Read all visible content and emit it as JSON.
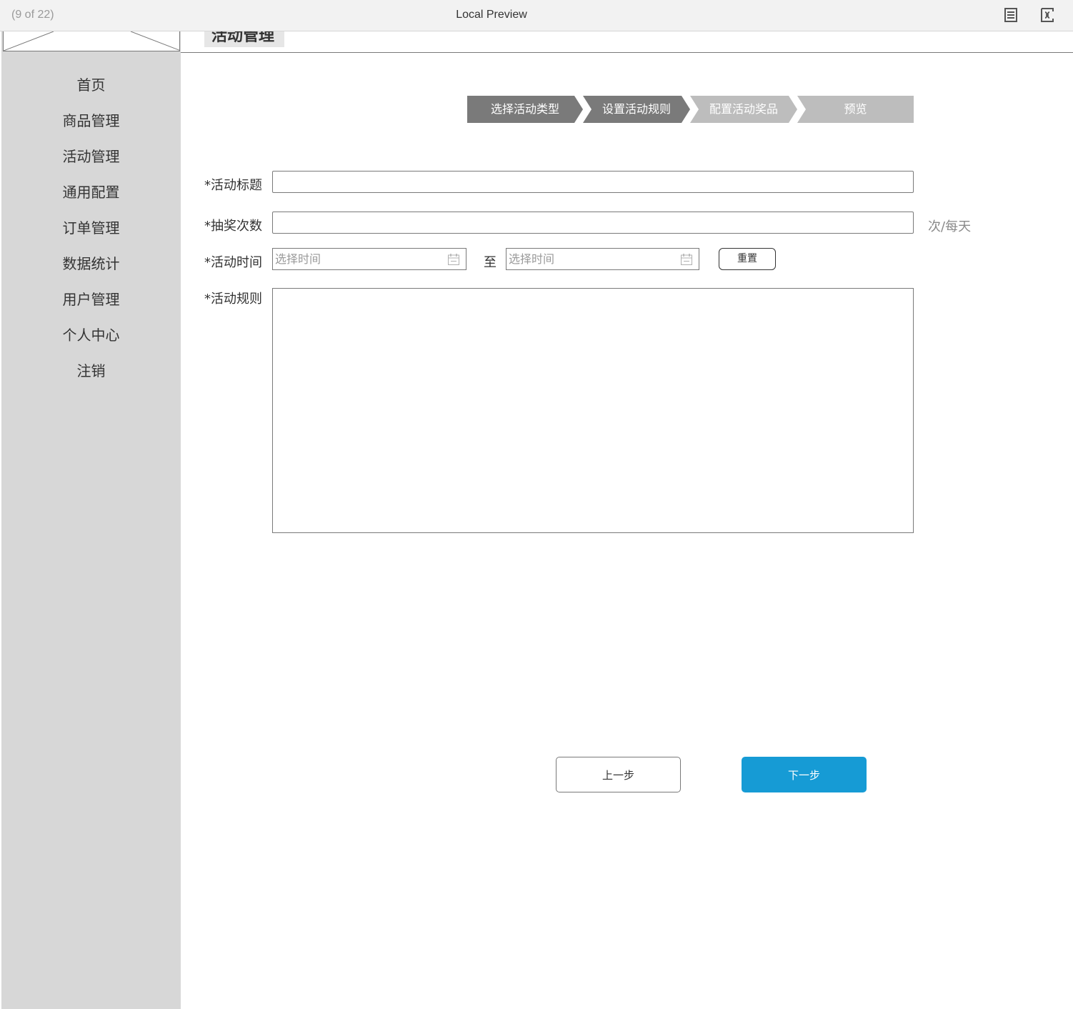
{
  "topbar": {
    "page_counter": "(9 of 22)",
    "title": "Local Preview",
    "icons": {
      "notes": "notes-page-icon",
      "variables": "variables-icon"
    }
  },
  "sidebar": {
    "logo": "logo-placeholder-image",
    "items": [
      {
        "label": "首页"
      },
      {
        "label": "商品管理"
      },
      {
        "label": "活动管理"
      },
      {
        "label": "通用配置"
      },
      {
        "label": "订单管理"
      },
      {
        "label": "数据统计"
      },
      {
        "label": "用户管理"
      },
      {
        "label": "个人中心"
      },
      {
        "label": "注销"
      }
    ]
  },
  "header": {
    "title": "活动管理"
  },
  "stepper": {
    "steps": [
      {
        "label": "选择活动类型",
        "state": "done"
      },
      {
        "label": "设置活动规则",
        "state": "current"
      },
      {
        "label": "配置活动奖品",
        "state": "pending"
      },
      {
        "label": "预览",
        "state": "pending"
      }
    ],
    "active_color": "#7a7a7a",
    "inactive_color": "#bdbdbd"
  },
  "form": {
    "title_label": "*活动标题",
    "title_value": "",
    "draws_label": "*抽奖次数",
    "draws_value": "",
    "draws_unit": "次/每天",
    "time_label": "*活动时间",
    "start_placeholder": "选择时间",
    "to_label": "至",
    "end_placeholder": "选择时间",
    "calendar_icon": "calendar-icon",
    "reset_label": "重置",
    "rules_label": "*活动规则",
    "rules_value": ""
  },
  "actions": {
    "prev_label": "上一步",
    "next_label": "下一步",
    "next_color": "#169bd5"
  }
}
